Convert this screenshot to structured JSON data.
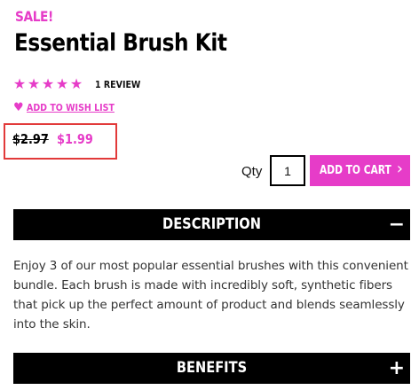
{
  "product": {
    "sale_label": "SALE!",
    "title": "Essential Brush Kit",
    "rating": {
      "stars": 5,
      "max": 5,
      "review_count_label": "1 REVIEW"
    },
    "wishlist_label": "ADD TO WISH LIST",
    "old_price": "$2.97",
    "new_price": "$1.99"
  },
  "cart": {
    "qty_label": "Qty",
    "qty_value": "1",
    "add_to_cart_label": "ADD TO CART"
  },
  "sections": {
    "description": {
      "title": "DESCRIPTION",
      "toggle": "−",
      "body": "Enjoy 3 of our most popular essential brushes with this convenient bundle. Each brush is made with incredibly soft, synthetic fibers that pick up the perfect amount of product and blends seamlessly into the skin."
    },
    "benefits": {
      "title": "BENEFITS",
      "toggle": "+"
    }
  },
  "colors": {
    "accent": "#e63cc8",
    "highlight_border": "#e23a3a",
    "bar": "#000000"
  },
  "icons": {
    "star": "star-icon",
    "heart": "heart-icon",
    "chevron": "chevron-right-icon"
  }
}
